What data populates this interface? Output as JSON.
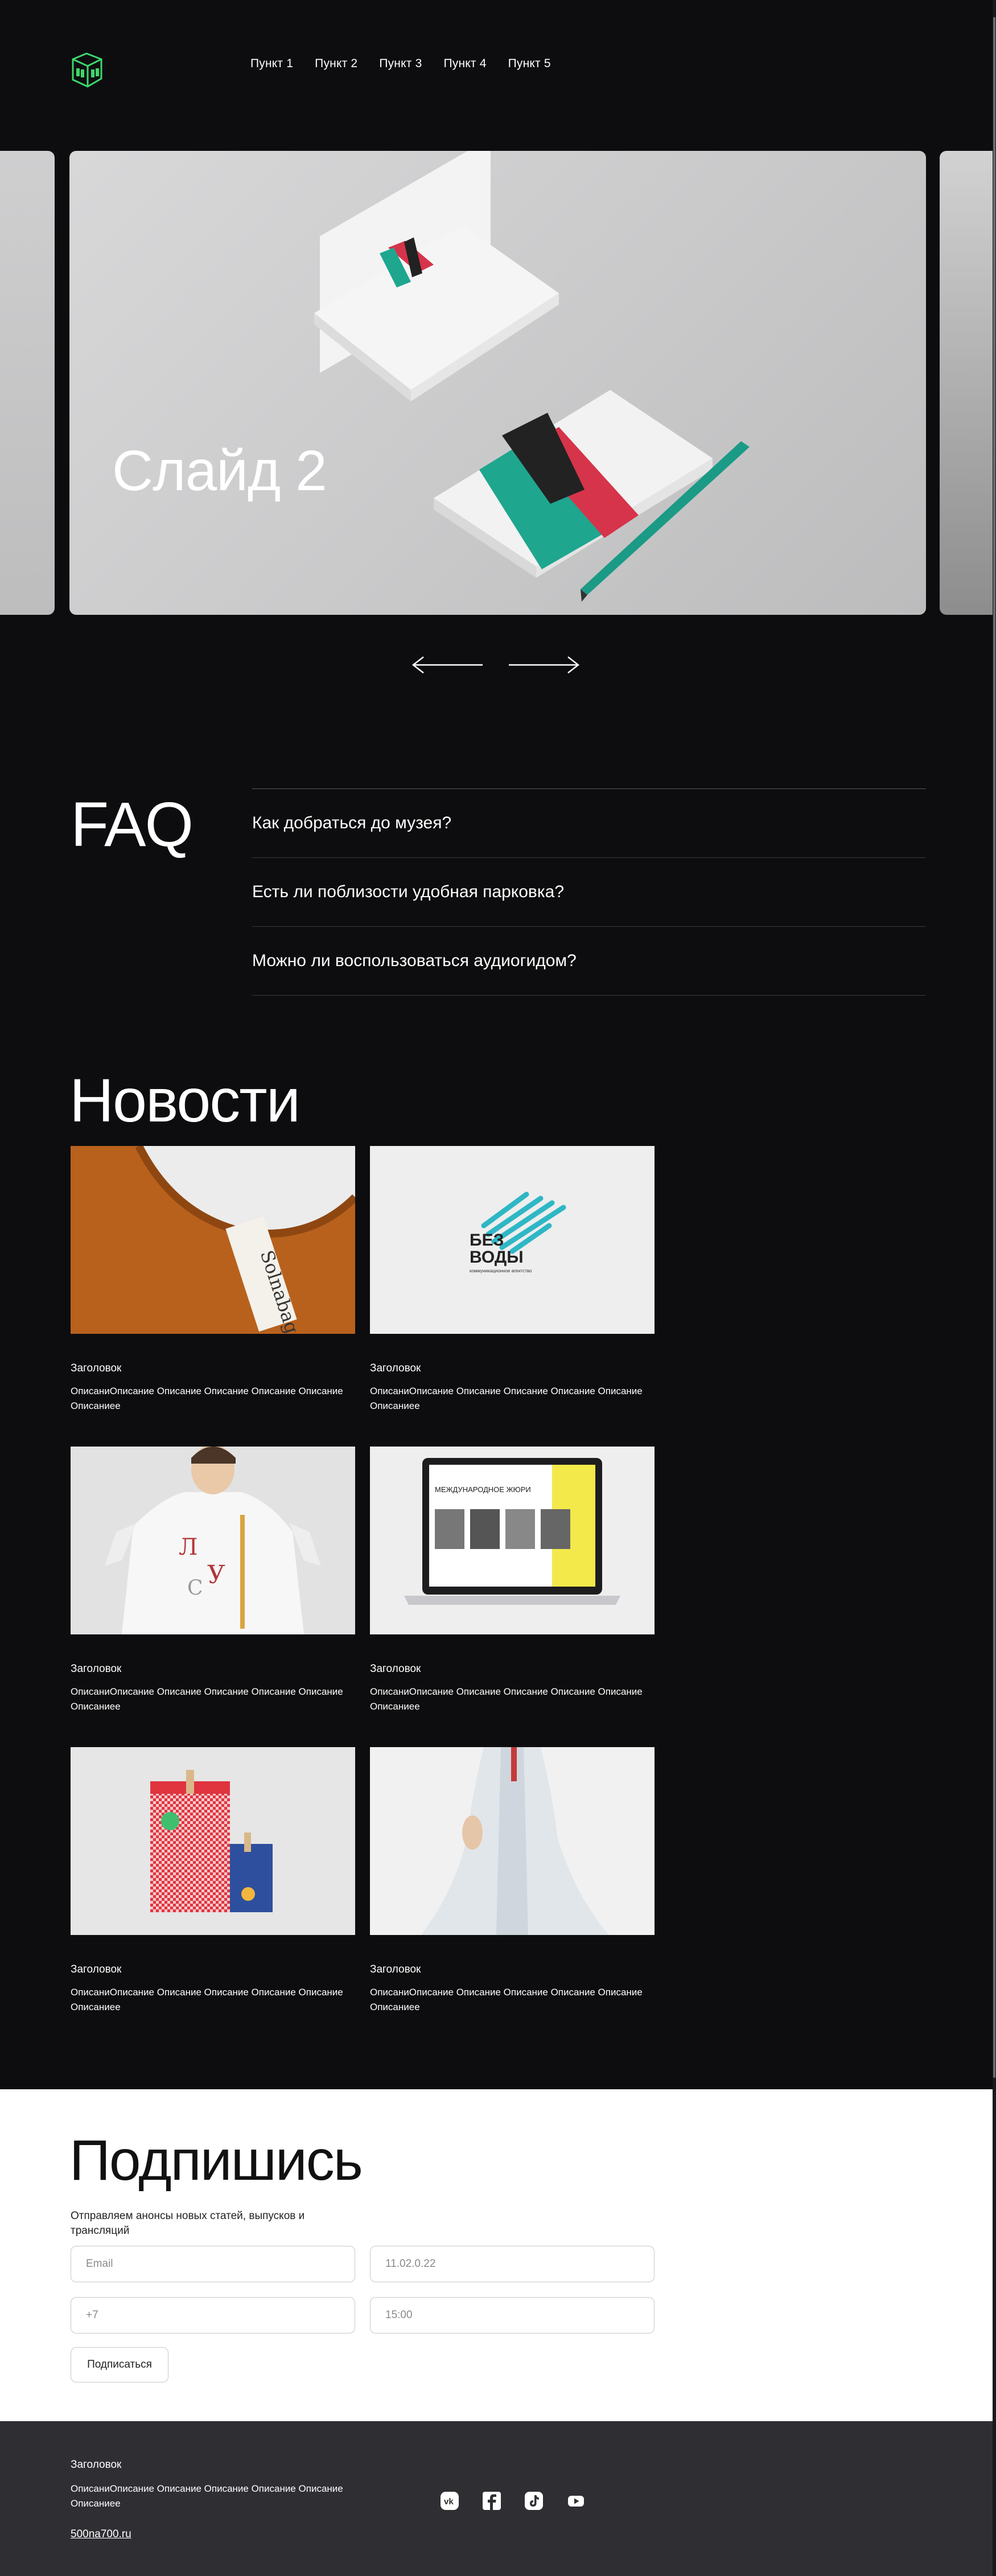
{
  "nav": {
    "items": [
      "Пункт 1",
      "Пункт 2",
      "Пункт 3",
      "Пункт 4",
      "Пункт 5"
    ]
  },
  "slider": {
    "title": "Слайд 2"
  },
  "faq": {
    "title": "FAQ",
    "questions": [
      "Как добраться до музея?",
      "Есть ли поблизости удобная парковка?",
      "Можно ли воспользоваться аудиогидом?"
    ]
  },
  "news": {
    "title": "Новости",
    "items": [
      {
        "heading": "Заголовок",
        "desc": "ОписаниОписание Описание Описание Описание Описание Описаниее"
      },
      {
        "heading": "Заголовок",
        "desc": "ОписаниОписание Описание Описание Описание Описание Описаниее"
      },
      {
        "heading": "Заголовок",
        "desc": "ОписаниОписание Описание Описание Описание Описание Описаниее"
      },
      {
        "heading": "Заголовок",
        "desc": "ОписаниОписание Описание Описание Описание Описание Описаниее"
      },
      {
        "heading": "Заголовок",
        "desc": "ОписаниОписание Описание Описание Описание Описание Описаниее"
      },
      {
        "heading": "Заголовок",
        "desc": "ОписаниОписание Описание Описание Описание Описание Описаниее"
      }
    ],
    "image_texts": {
      "tag_brand": "Ѕolnabag",
      "bezvody_line1": "БЕЗ",
      "bezvody_line2": "ВОДЫ",
      "bezvody_sub": "коммуникационное агентство",
      "laptop_heading": "МЕЖДУНАРОДНОЕ ЖЮРИ"
    }
  },
  "subscribe": {
    "title": "Подпишись",
    "text": "Отправляем анонсы новых статей, выпусков и трансляций",
    "email_placeholder": "Email",
    "date_placeholder": "11.02.0.22",
    "phone_placeholder": "+7",
    "time_placeholder": "15:00",
    "button": "Подписаться"
  },
  "footer": {
    "heading": "Заголовок",
    "desc": "ОписаниОписание Описание Описание Описание Описание Описаниее",
    "link": "500na700.ru",
    "socials": [
      "vk-icon",
      "facebook-icon",
      "tiktok-icon",
      "youtube-icon"
    ]
  },
  "colors": {
    "background": "#0d0d0f",
    "footer": "#2f2e33",
    "logo": "#3dd66b"
  }
}
